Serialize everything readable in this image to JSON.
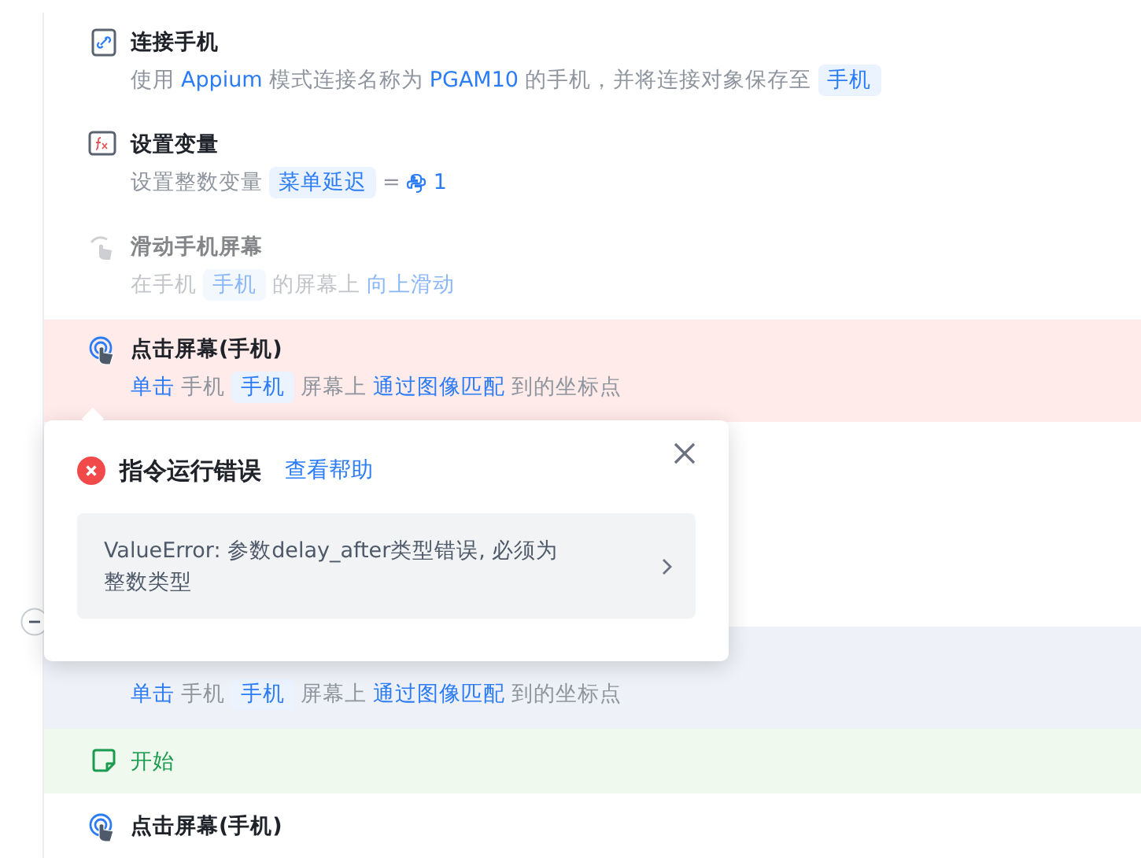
{
  "steps": [
    {
      "kind": "phone",
      "error": false,
      "hovered": false,
      "disabled": false,
      "title": "连接手机",
      "description": [
        {
          "kind": "plain",
          "text": "使用"
        },
        {
          "kind": "keyword",
          "text": "Appium"
        },
        {
          "kind": "plain",
          "text": "模式连接名称为"
        },
        {
          "kind": "keyword",
          "text": "PGAM10"
        },
        {
          "kind": "plain",
          "text": "的手机，并将连接对象保存至"
        },
        {
          "kind": "tag",
          "text": "手机"
        }
      ]
    },
    {
      "kind": "variable",
      "error": false,
      "hovered": false,
      "disabled": false,
      "title": "设置变量",
      "description": [
        {
          "kind": "plain",
          "text": "设置整数变量"
        },
        {
          "kind": "tag",
          "text": "菜单延迟"
        },
        {
          "kind": "plain",
          "text": "="
        },
        {
          "kind": "python",
          "text": "1"
        }
      ]
    },
    {
      "kind": "swipe",
      "error": false,
      "hovered": false,
      "disabled": true,
      "title": "滑动手机屏幕",
      "description": [
        {
          "kind": "plain",
          "text": "在手机"
        },
        {
          "kind": "tag",
          "text": "手机"
        },
        {
          "kind": "plain",
          "text": "的屏幕上"
        },
        {
          "kind": "keyword",
          "text": "向上滑动"
        }
      ]
    },
    {
      "kind": "tap",
      "error": true,
      "hovered": false,
      "disabled": false,
      "title": "点击屏幕(手机)",
      "description": [
        {
          "kind": "keyword",
          "text": "单击"
        },
        {
          "kind": "plain",
          "text": "手机"
        },
        {
          "kind": "tag",
          "text": "手机"
        },
        {
          "kind": "plain",
          "text": "屏幕上"
        },
        {
          "kind": "keyword",
          "text": "通过图像匹配"
        },
        {
          "kind": "plain",
          "text": "到的坐标点"
        }
      ]
    },
    {
      "kind": "tap",
      "error": false,
      "hovered": true,
      "disabled": false,
      "description": [
        {
          "kind": "keyword",
          "text": "单击"
        },
        {
          "kind": "plain",
          "text": "手机"
        },
        {
          "kind": "tag",
          "text": "手机"
        },
        {
          "kind": "plain",
          "text": "屏幕上"
        },
        {
          "kind": "keyword",
          "text": "通过图像匹配"
        },
        {
          "kind": "plain",
          "text": "到的坐标点"
        }
      ]
    },
    {
      "kind": "note",
      "error": false,
      "hovered": false,
      "disabled": false,
      "title": "开始"
    },
    {
      "kind": "tap",
      "error": false,
      "hovered": false,
      "disabled": false,
      "title": "点击屏幕(手机)"
    }
  ],
  "error_popup": {
    "title": "指令运行错误",
    "help_link": "查看帮助",
    "message": "ValueError: 参数delay_after类型错误, 必须为整数类型"
  }
}
